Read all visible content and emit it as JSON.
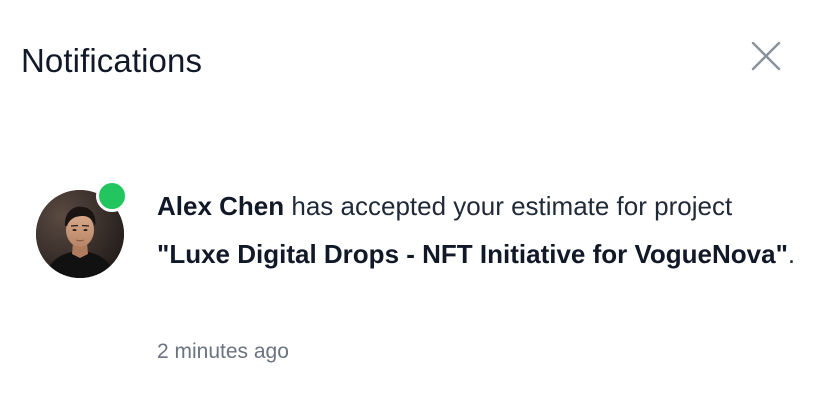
{
  "header": {
    "title": "Notifications",
    "close_icon": "close-icon"
  },
  "notification": {
    "actor_name": "Alex Chen",
    "action_text": " has accepted your estimate for project ",
    "project_name": "\"Luxe Digital Drops - NFT Initiative for VogueNova\"",
    "end_punctuation": ".",
    "timestamp": "2 minutes ago",
    "online_status": "online",
    "status_color": "#22c55e"
  }
}
